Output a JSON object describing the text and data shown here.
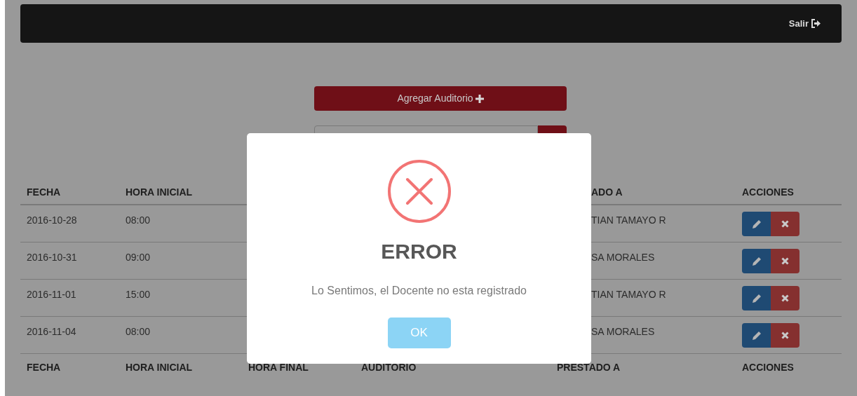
{
  "navbar": {
    "logout": "Salir"
  },
  "add_button": "Agregar Auditorio",
  "table": {
    "header": {
      "fecha": "FECHA",
      "hora_inicial": "HORA INICIAL",
      "prestado_a": "ADO A",
      "acciones": "ACCIONES"
    },
    "rows": [
      {
        "fecha": "2016-10-28",
        "hora_inicial": "08:00",
        "prestado_a": "TIAN TAMAYO R"
      },
      {
        "fecha": "2016-10-31",
        "hora_inicial": "09:00",
        "prestado_a": "SA MORALES"
      },
      {
        "fecha": "2016-11-01",
        "hora_inicial": "15:00",
        "prestado_a": "TIAN TAMAYO R"
      },
      {
        "fecha": "2016-11-04",
        "hora_inicial": "08:00",
        "prestado_a": "SA MORALES"
      }
    ],
    "footer": [
      "FECHA",
      "HORA INICIAL",
      "HORA FINAL",
      "AUDITORIO",
      "PRESTADO A",
      "ACCIONES"
    ]
  },
  "modal": {
    "kind": "error",
    "title": "ERROR",
    "message": "Lo Sentimos, el Docente no esta registrado",
    "button": "OK"
  }
}
